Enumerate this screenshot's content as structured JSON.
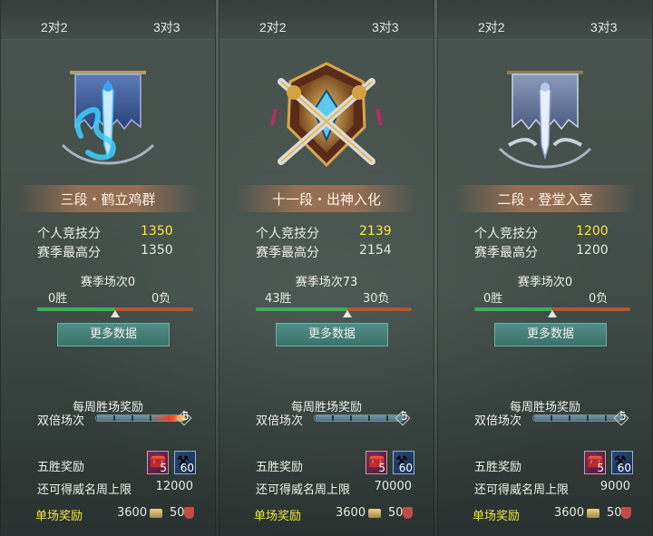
{
  "tabs": [
    "2对2",
    "3对3"
  ],
  "labels": {
    "personal_score": "个人竞技分",
    "season_high": "赛季最高分",
    "season_matches_prefix": "赛季场次",
    "win_suffix": "胜",
    "loss_suffix": "负",
    "more_data": "更多数据",
    "weekly_reward": "每周胜场奖励",
    "double_matches": "双倍场次",
    "five_win_reward": "五胜奖励",
    "remaining_cap": "还可得威名周上限",
    "single_reward": "单场奖励"
  },
  "panels": [
    {
      "tab1": "2对2",
      "tab2": "3对3",
      "rank": "三段・鹤立鸡群",
      "emblem": "blue-dragon-banner-icon",
      "score": "1350",
      "season_high": "1350",
      "season_matches": "赛季场次0",
      "wins": "0胜",
      "losses": "0负",
      "win_ratio": 0.5,
      "double_progress": 5,
      "double_max": 5,
      "double_label": "5",
      "double_on_fire": true,
      "chest_count": "5",
      "axe_count": "60",
      "remaining_cap": "12000",
      "coin_reward": "3600",
      "badge_reward": "50"
    },
    {
      "tab1": "2对2",
      "tab2": "3对3",
      "rank": "十一段・出神入化",
      "emblem": "golden-crossed-swords-icon",
      "score": "2139",
      "season_high": "2154",
      "season_matches": "赛季场次73",
      "wins": "43胜",
      "losses": "30负",
      "win_ratio": 0.589,
      "double_progress": 5,
      "double_max": 5,
      "double_label": "5",
      "double_on_fire": false,
      "chest_count": "5",
      "axe_count": "60",
      "remaining_cap": "70000",
      "coin_reward": "3600",
      "badge_reward": "50"
    },
    {
      "tab1": "2对2",
      "tab2": "3对3",
      "rank": "二段・登堂入室",
      "emblem": "silver-sword-banner-icon",
      "score": "1200",
      "season_high": "1200",
      "season_matches": "赛季场次0",
      "wins": "0胜",
      "losses": "0负",
      "win_ratio": 0.5,
      "double_progress": 5,
      "double_max": 5,
      "double_label": "5",
      "double_on_fire": false,
      "chest_count": "5",
      "axe_count": "60",
      "remaining_cap": "9000",
      "coin_reward": "3600",
      "badge_reward": "50"
    }
  ],
  "colors": {
    "score_highlight": "#ffe838",
    "single_reward_label": "#f0e640",
    "win_bar": "#3fae5a",
    "loss_bar": "#b0582e",
    "button": "#4f8f86"
  }
}
